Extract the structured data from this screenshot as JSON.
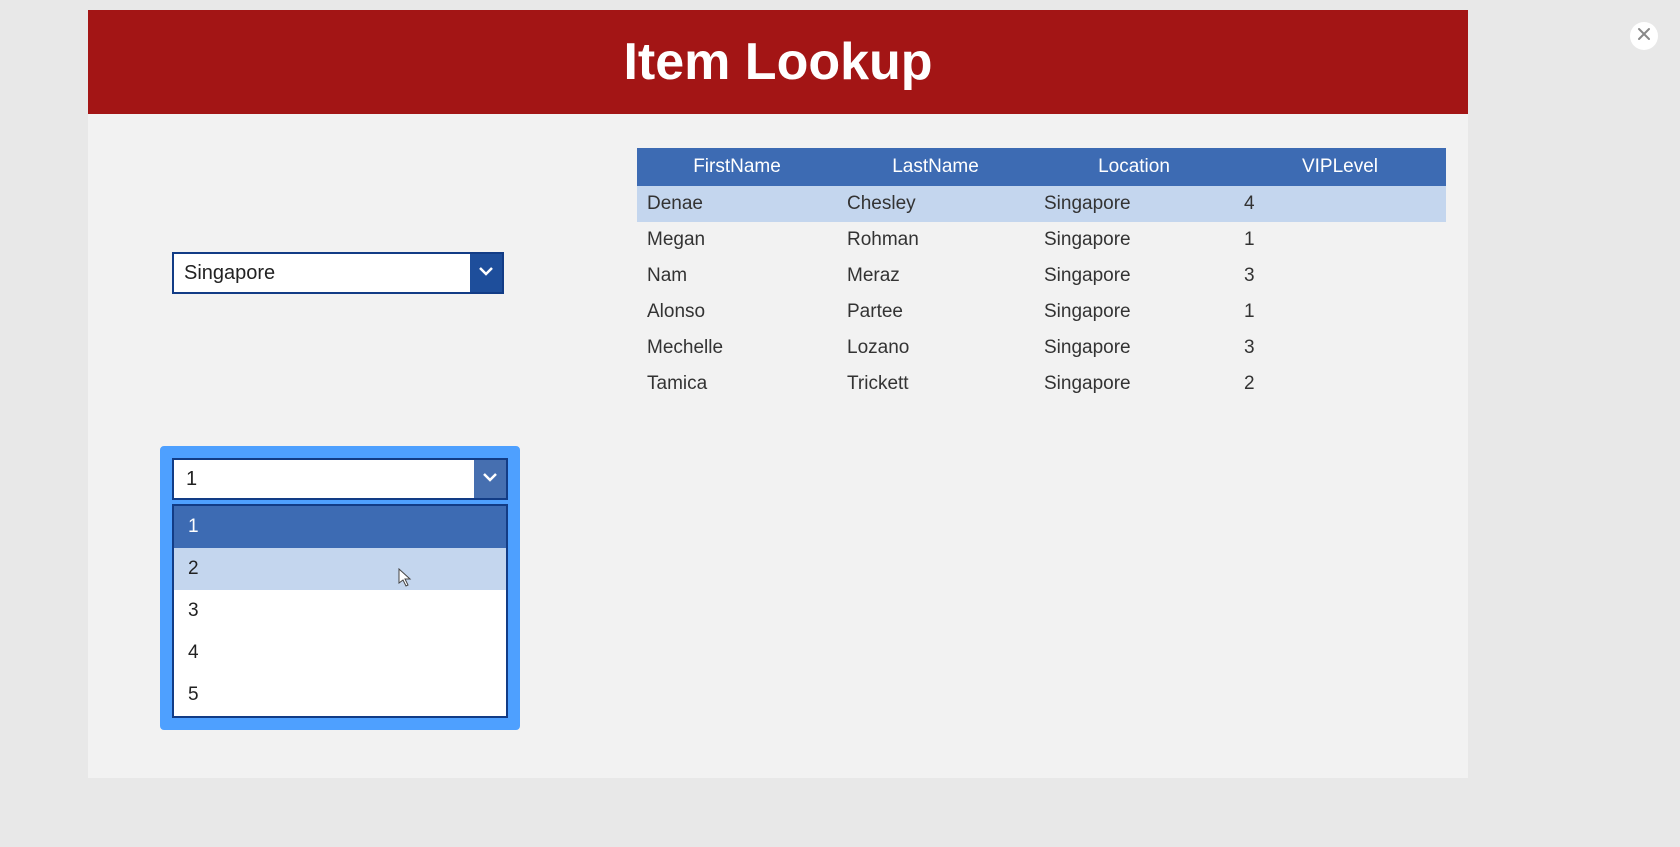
{
  "title": "Item Lookup",
  "close_icon": "×",
  "location_dropdown": {
    "selected": "Singapore"
  },
  "vip_dropdown": {
    "selected": "1",
    "selected_index": 0,
    "hover_index": 1,
    "options": [
      "1",
      "2",
      "3",
      "4",
      "5"
    ]
  },
  "table": {
    "headers": [
      "FirstName",
      "LastName",
      "Location",
      "VIPLevel"
    ],
    "rows": [
      {
        "first": "Denae",
        "last": "Chesley",
        "location": "Singapore",
        "vip": "4"
      },
      {
        "first": "Megan",
        "last": "Rohman",
        "location": "Singapore",
        "vip": "1"
      },
      {
        "first": "Nam",
        "last": "Meraz",
        "location": "Singapore",
        "vip": "3"
      },
      {
        "first": "Alonso",
        "last": "Partee",
        "location": "Singapore",
        "vip": "1"
      },
      {
        "first": "Mechelle",
        "last": "Lozano",
        "location": "Singapore",
        "vip": "3"
      },
      {
        "first": "Tamica",
        "last": "Trickett",
        "location": "Singapore",
        "vip": "2"
      }
    ]
  }
}
